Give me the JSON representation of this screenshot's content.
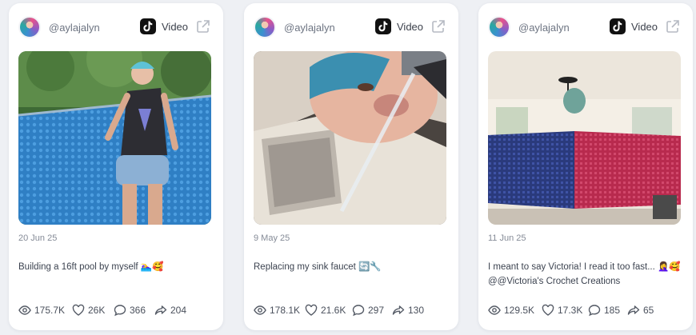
{
  "colors": {
    "background": "#eef0f4",
    "card": "#ffffff",
    "text": "#3c4350",
    "muted": "#858b97"
  },
  "posts": [
    {
      "author": "@aylajalyn",
      "platform_icon": "tiktok-icon",
      "type_label": "Video",
      "date": "20 Jun 25",
      "caption": "Building a 16ft pool by myself 🏊‍♀️🥰",
      "stats": {
        "views": "175.7K",
        "likes": "26K",
        "comments": "366",
        "shares": "204"
      }
    },
    {
      "author": "@aylajalyn",
      "platform_icon": "tiktok-icon",
      "type_label": "Video",
      "date": "9 May 25",
      "caption": "Replacing my sink faucet 🔄🔧",
      "stats": {
        "views": "178.1K",
        "likes": "21.6K",
        "comments": "297",
        "shares": "130"
      }
    },
    {
      "author": "@aylajalyn",
      "platform_icon": "tiktok-icon",
      "type_label": "Video",
      "date": "11 Jun 25",
      "caption": "I meant to say Victoria! I read it too fast... 🤦‍♀️🥰 @@Victoria's Crochet Creations",
      "stats": {
        "views": "129.5K",
        "likes": "17.3K",
        "comments": "185",
        "shares": "65"
      }
    }
  ]
}
